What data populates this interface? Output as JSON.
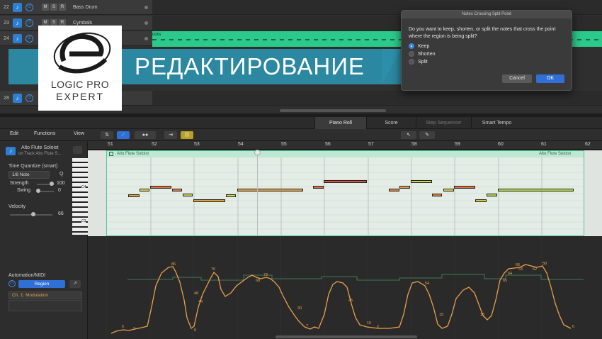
{
  "tracks": [
    {
      "num": "22",
      "name": "Bass Drum"
    },
    {
      "num": "23",
      "name": "Cymbals"
    },
    {
      "num": "24",
      "name": ""
    },
    {
      "num": "28",
      "name": ""
    }
  ],
  "track_region_label": "ocks",
  "banner": {
    "title": "РЕДАКТИРОВАНИЕ",
    "logo_line1": "LOGIC PRO",
    "logo_line2": "EXPERT"
  },
  "dialog": {
    "title": "Notes Crossing Split Point",
    "message": "Do you want to keep, shorten, or split the notes that cross the point where the region is being split?",
    "options": [
      "Keep",
      "Shorten",
      "Split"
    ],
    "selected": "Keep",
    "cancel_label": "Cancel",
    "ok_label": "OK"
  },
  "tabs": [
    "Piano Roll",
    "Score",
    "Step Sequencer",
    "Smart Tempo"
  ],
  "toolbar": {
    "edit": "Edit",
    "functions": "Functions",
    "view": "View"
  },
  "inspector": {
    "region_name": "Alto Flute Soloist",
    "track_ref": "on Track Alto Flute S...",
    "time_quantize": "Time Quantize (smart)",
    "quantize_value": "1/8 Note",
    "q_label": "Q",
    "strength_label": "Strength",
    "strength_value": "100",
    "swing_label": "Swing",
    "swing_value": "0",
    "velocity_label": "Velocity",
    "velocity_value": "66",
    "automation_label": "Automation/MIDI",
    "automation_mode": "Region",
    "automation_param": "Ch. 1: Modulation"
  },
  "piano": {
    "c4": "C4",
    "c3": "C3"
  },
  "ruler": {
    "bars": [
      "51",
      "52",
      "53",
      "54",
      "55",
      "56",
      "57",
      "58",
      "59",
      "60",
      "61",
      "62"
    ]
  },
  "region": {
    "name": "Alto Flute Soloist",
    "name_right": "Alto Flute Soloist"
  },
  "automation_labels": [
    "86",
    "76",
    "73",
    "68",
    "66",
    "58",
    "63",
    "62",
    "64",
    "65",
    "54",
    "48",
    "44",
    "45",
    "30",
    "19",
    "18",
    "10",
    "8",
    "7",
    "6",
    "5",
    "3",
    "2"
  ],
  "colors": {
    "accent": "#2c8ea9",
    "region": "#52c99a",
    "automation": "#e8a04a",
    "dialog_primary": "#2f6fd6"
  }
}
